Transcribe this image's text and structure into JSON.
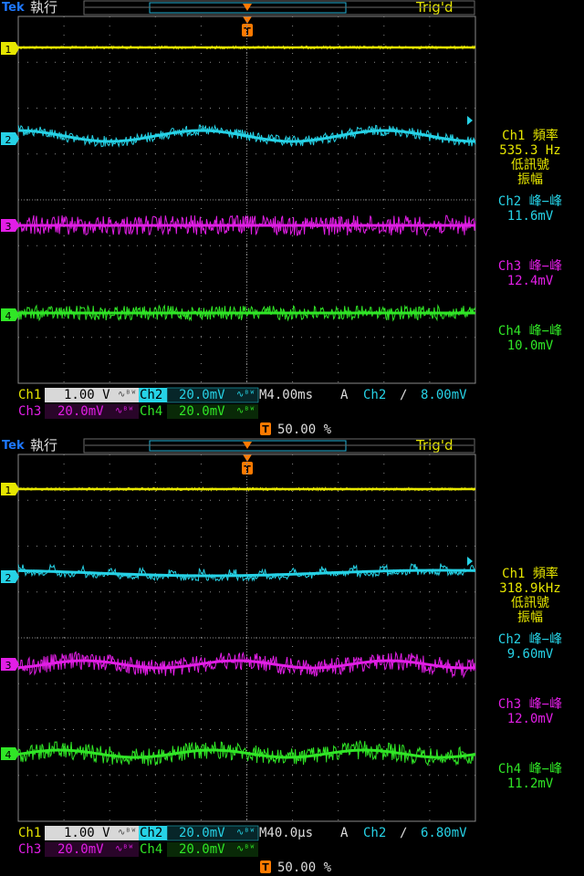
{
  "colors": {
    "ch1": "#e6e600",
    "ch2": "#26d2e6",
    "ch3": "#e21ee6",
    "ch4": "#30e626",
    "grid": "#8a8a8a",
    "brand": "#1e78ff"
  },
  "channel_markers": [
    "1",
    "2",
    "3",
    "4"
  ],
  "trigger_marker": "T",
  "scopes": [
    {
      "header": {
        "brand": "Tek",
        "run_state": "執行",
        "trig_status": "Trig'd"
      },
      "chart_data": {
        "type": "line",
        "series": [
          {
            "name": "Ch1",
            "shape": "flat",
            "noise_amplitude": "low"
          },
          {
            "name": "Ch2",
            "shape": "sine",
            "cycles_on_screen": 2.5
          },
          {
            "name": "Ch3",
            "shape": "noise"
          },
          {
            "name": "Ch4",
            "shape": "noise"
          }
        ],
        "grid": {
          "divisions_x": 10,
          "divisions_y": 8
        }
      },
      "measurements": {
        "ch1_title": "Ch1 頻率",
        "ch1_value": "535.3 Hz",
        "ch1_note_1": "低訊號",
        "ch1_note_2": "振幅",
        "ch2_title": "Ch2 峰−峰",
        "ch2_value": "11.6mV",
        "ch3_title": "Ch3 峰−峰",
        "ch3_value": "12.4mV",
        "ch4_title": "Ch4 峰−峰",
        "ch4_value": "10.0mV"
      },
      "footer": {
        "ch1_label": "Ch1",
        "ch1_scale": "1.00 V",
        "ch2_label": "Ch2",
        "ch2_scale": "20.0mV",
        "ch3_label": "Ch3",
        "ch3_scale": "20.0mV",
        "ch4_label": "Ch4",
        "ch4_scale": "20.0mV",
        "bw_mark": "∿ᴮᵂ",
        "timebase": "M4.00ms",
        "trig_mode": "A",
        "trig_source": "Ch2",
        "trig_slope": "∕",
        "trig_level": "8.00mV",
        "trig_position": "50.00 %"
      }
    },
    {
      "header": {
        "brand": "Tek",
        "run_state": "執行",
        "trig_status": "Trig'd"
      },
      "chart_data": {
        "type": "line",
        "series": [
          {
            "name": "Ch1",
            "shape": "flat",
            "noise_amplitude": "low"
          },
          {
            "name": "Ch2",
            "shape": "ripple",
            "cycles_on_screen": 15
          },
          {
            "name": "Ch3",
            "shape": "noise-band"
          },
          {
            "name": "Ch4",
            "shape": "noise-band"
          }
        ],
        "grid": {
          "divisions_x": 10,
          "divisions_y": 8
        }
      },
      "measurements": {
        "ch1_title": "Ch1 頻率",
        "ch1_value": "318.9kHz",
        "ch1_note_1": "低訊號",
        "ch1_note_2": "振幅",
        "ch2_title": "Ch2 峰−峰",
        "ch2_value": "9.60mV",
        "ch3_title": "Ch3 峰−峰",
        "ch3_value": "12.0mV",
        "ch4_title": "Ch4 峰−峰",
        "ch4_value": "11.2mV"
      },
      "footer": {
        "ch1_label": "Ch1",
        "ch1_scale": "1.00 V",
        "ch2_label": "Ch2",
        "ch2_scale": "20.0mV",
        "ch3_label": "Ch3",
        "ch3_scale": "20.0mV",
        "ch4_label": "Ch4",
        "ch4_scale": "20.0mV",
        "bw_mark": "∿ᴮᵂ",
        "timebase": "M40.0μs",
        "trig_mode": "A",
        "trig_source": "Ch2",
        "trig_slope": "∕",
        "trig_level": "6.80mV",
        "trig_position": "50.00 %"
      }
    }
  ]
}
